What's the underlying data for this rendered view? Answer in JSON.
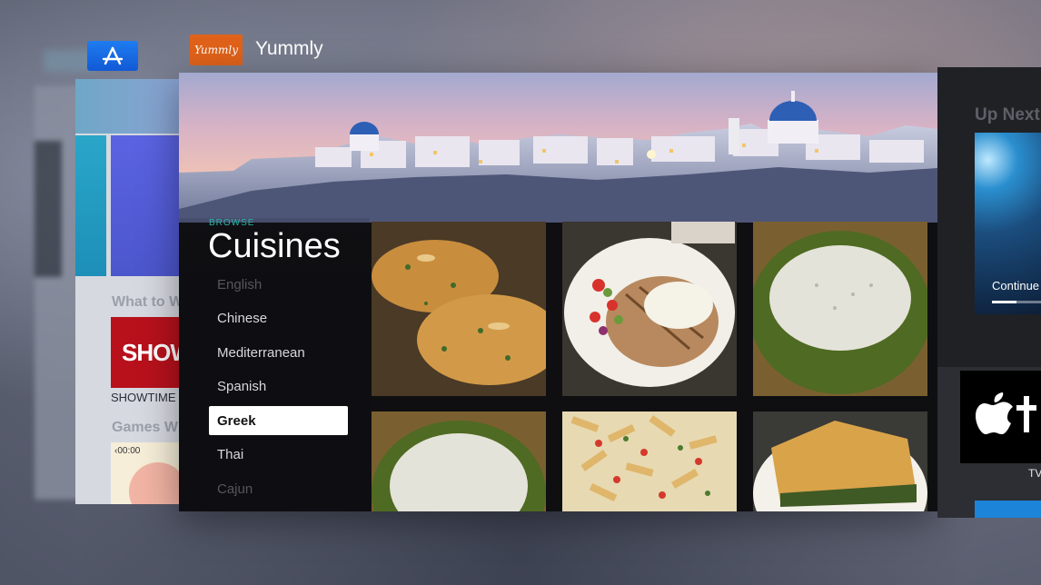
{
  "switcher": {
    "appstore": {
      "icon": "app-store-icon"
    },
    "app_title": "Yummly",
    "app_icon_text": "Yummly"
  },
  "appstore_card": {
    "section_what_to_watch": "What to W",
    "showtime_tile_text": "SHOWT",
    "showtime_label": "SHOWTIME",
    "section_games": "Games W",
    "game_time": "‹00:00"
  },
  "yummly": {
    "browse_label": "BROWSE",
    "title": "Cuisines",
    "cuisines": [
      {
        "label": "English",
        "state": "faded"
      },
      {
        "label": "Chinese",
        "state": "normal"
      },
      {
        "label": "Mediterranean",
        "state": "normal"
      },
      {
        "label": "Spanish",
        "state": "normal"
      },
      {
        "label": "Greek",
        "state": "selected"
      },
      {
        "label": "Thai",
        "state": "normal"
      },
      {
        "label": "Cajun",
        "state": "faded"
      }
    ],
    "recipes": [
      {
        "name": "herb-chicken"
      },
      {
        "name": "grilled-fish-tzatziki"
      },
      {
        "name": "tzatziki-bowl"
      },
      {
        "name": "tzatziki-bowl-2"
      },
      {
        "name": "pasta-salad"
      },
      {
        "name": "spanakopita"
      }
    ]
  },
  "upnext_card": {
    "title": "Up Next",
    "continue_label": "Continue",
    "progress_fraction": 0.5,
    "tv_label": "TV"
  },
  "colors": {
    "accent_teal": "#29b5a6",
    "yummly_orange": "#e0621a",
    "appstore_blue": "#1f7cf0",
    "showtime_red": "#b8111c"
  }
}
